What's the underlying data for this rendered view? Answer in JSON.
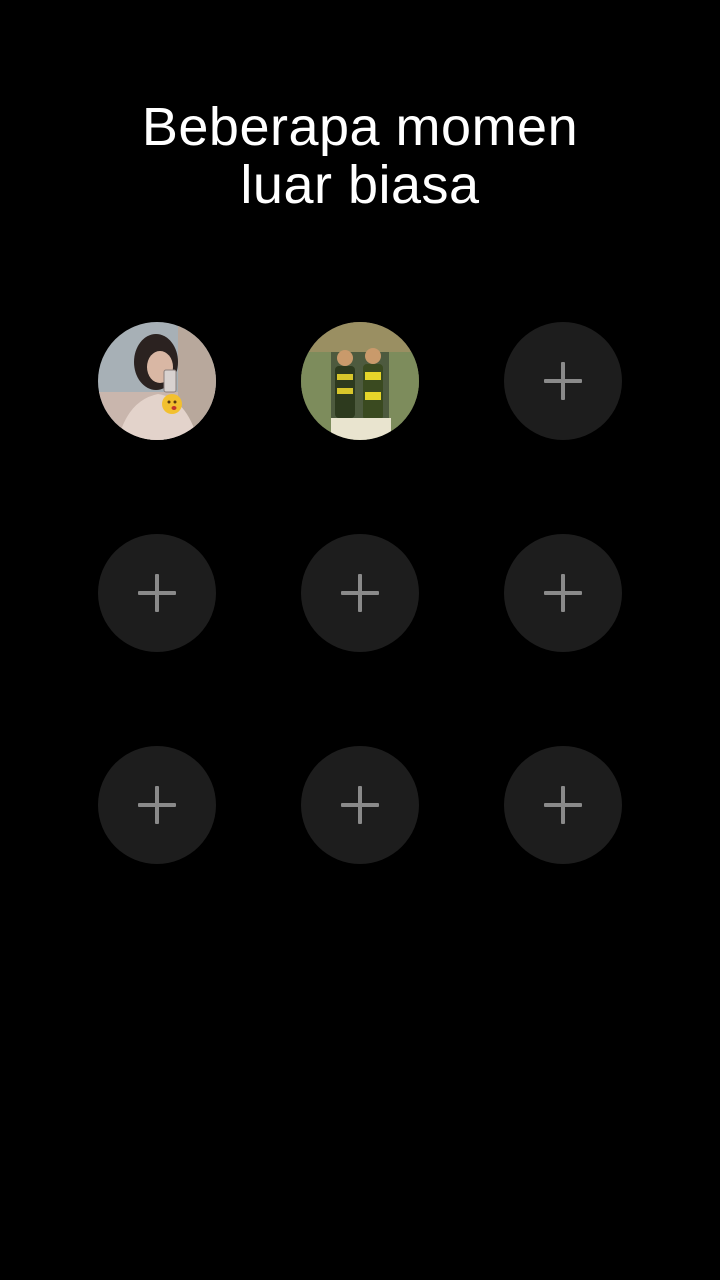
{
  "header": {
    "title_line1": "Beberapa momen",
    "title_line2": "luar biasa"
  },
  "grid": {
    "slots": [
      {
        "state": "filled",
        "content": "photo-portrait"
      },
      {
        "state": "filled",
        "content": "photo-couple"
      },
      {
        "state": "empty",
        "icon": "plus-icon"
      },
      {
        "state": "empty",
        "icon": "plus-icon"
      },
      {
        "state": "empty",
        "icon": "plus-icon"
      },
      {
        "state": "empty",
        "icon": "plus-icon"
      },
      {
        "state": "empty",
        "icon": "plus-icon"
      },
      {
        "state": "empty",
        "icon": "plus-icon"
      },
      {
        "state": "empty",
        "icon": "plus-icon"
      }
    ]
  },
  "colors": {
    "background": "#000000",
    "title_text": "#ffffff",
    "slot_fill": "#1d1d1d",
    "plus_icon": "#8a8a8a"
  }
}
